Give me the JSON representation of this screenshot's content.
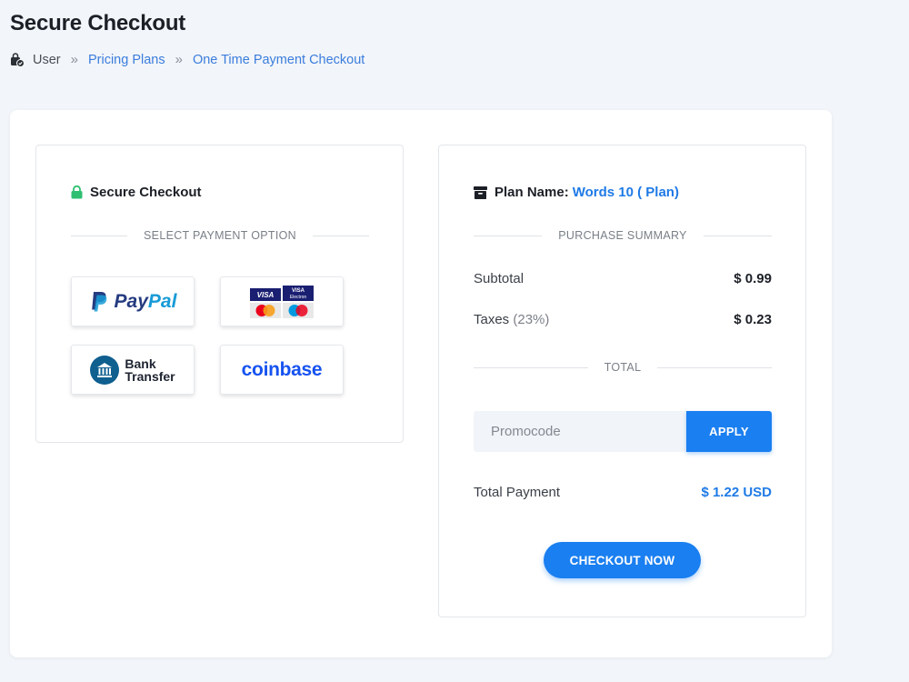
{
  "page": {
    "title": "Secure Checkout"
  },
  "breadcrumb": {
    "items": [
      "User",
      "Pricing Plans",
      "One Time Payment Checkout"
    ],
    "separator": "»"
  },
  "payment_panel": {
    "heading": "Secure Checkout",
    "heading_icon": "lock-icon",
    "divider_label": "SELECT PAYMENT OPTION",
    "options": [
      {
        "name": "PayPal",
        "logo_parts": [
          "Pay",
          "Pal"
        ]
      },
      {
        "name": "cards",
        "card_labels": [
          "VISA",
          "VISA Electron",
          "MasterCard",
          "Maestro"
        ]
      },
      {
        "name": "Bank Transfer",
        "logo_lines": [
          "Bank",
          "Transfer"
        ]
      },
      {
        "name": "coinbase",
        "logo_text": "coinbase"
      }
    ]
  },
  "summary_panel": {
    "plan_label": "Plan Name:",
    "plan_value": "Words 10 ( Plan)",
    "heading_icon": "archive-icon",
    "divider_label": "PURCHASE SUMMARY",
    "subtotal_label": "Subtotal",
    "subtotal_value": "$ 0.99",
    "taxes_label": "Taxes",
    "taxes_rate": "(23%)",
    "taxes_value": "$ 0.23",
    "total_divider": "TOTAL",
    "promo_placeholder": "Promocode",
    "apply_label": "APPLY",
    "total_payment_label": "Total Payment",
    "total_payment_value": "$ 1.22 USD",
    "checkout_label": "CHECKOUT NOW"
  },
  "colors": {
    "accent": "#1a7ff0",
    "link": "#3b7ddd",
    "lock": "#2fbf71",
    "paypal_dark": "#253b80",
    "paypal_light": "#179bd7",
    "coinbase": "#1652f0",
    "bank_circle": "#0f5f8f"
  }
}
